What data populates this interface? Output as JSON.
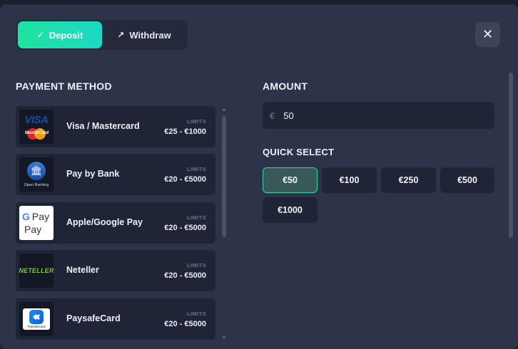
{
  "tabs": {
    "deposit": {
      "label": "Deposit",
      "icon": "check-icon"
    },
    "withdraw": {
      "label": "Withdraw",
      "icon": "arrow-up-right-icon"
    }
  },
  "close": {
    "icon": "close-icon",
    "glyph": "✕"
  },
  "payment": {
    "title": "PAYMENT METHOD",
    "limits_label": "LIMITS",
    "methods": [
      {
        "name": "Visa / Mastercard",
        "limits": "€25 - €1000",
        "logo": "visa-mastercard",
        "logo_texts": [
          "VISA",
          "MasterCard"
        ]
      },
      {
        "name": "Pay by Bank",
        "limits": "€20 - €5000",
        "logo": "open-banking",
        "logo_texts": [
          "Open Banking"
        ]
      },
      {
        "name": "Apple/Google Pay",
        "limits": "€20 - €5000",
        "logo": "apple-google-pay",
        "logo_texts": [
          "G Pay",
          "Pay"
        ]
      },
      {
        "name": "Neteller",
        "limits": "€20 - €5000",
        "logo": "neteller",
        "logo_texts": [
          "NETELLER"
        ]
      },
      {
        "name": "PaysafeCard",
        "limits": "€20 - €5000",
        "logo": "paysafecard",
        "logo_texts": [
          "Paysafecard"
        ]
      }
    ]
  },
  "amount": {
    "title": "AMOUNT",
    "currency_symbol": "€",
    "value": "50"
  },
  "quick_select": {
    "title": "QUICK SELECT",
    "options": [
      "€50",
      "€100",
      "€250",
      "€500",
      "€1000"
    ],
    "selected": "€50"
  },
  "colors": {
    "accent_start": "#1fe39f",
    "accent_end": "#1cd8c4",
    "panel": "#2d3349",
    "card": "#1f2436",
    "selected_bg": "#375a58",
    "selected_border": "#2fd9a0"
  }
}
